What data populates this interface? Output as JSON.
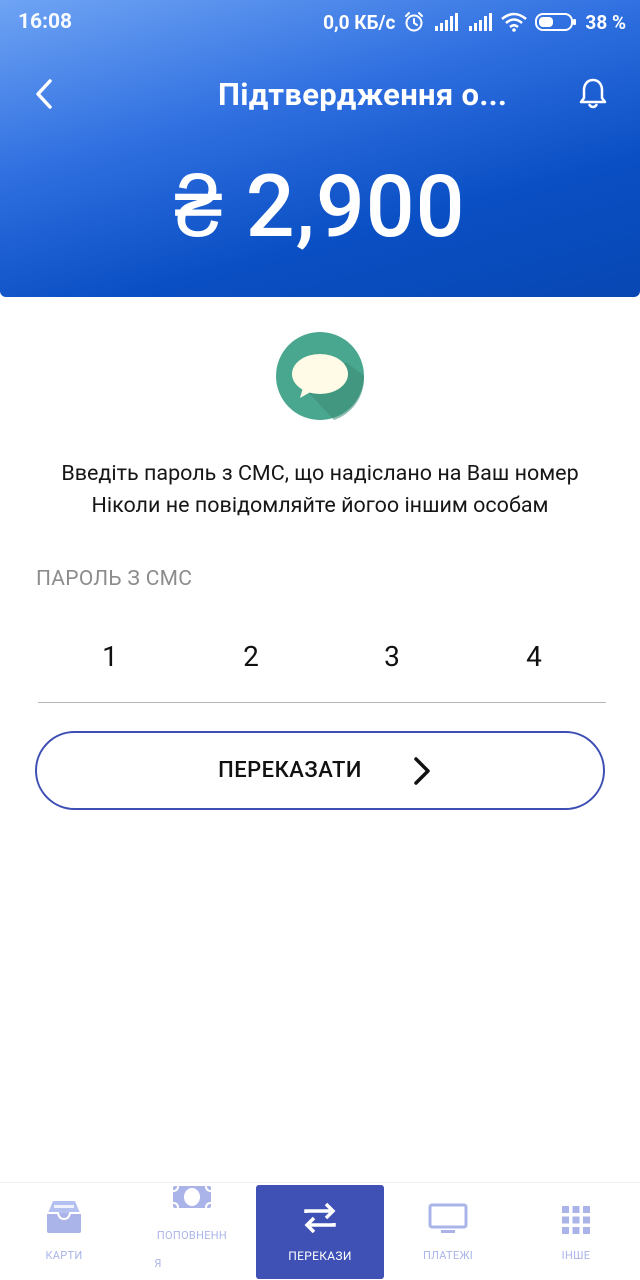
{
  "status_bar": {
    "time": "16:08",
    "speed": "0,0 КБ/с",
    "battery": "38 %",
    "icons": [
      "alarm-icon",
      "signal-icon",
      "signal-icon",
      "wifi-icon",
      "battery-icon"
    ]
  },
  "header": {
    "title": "Підтвердження о...",
    "amount": "₴ 2,900",
    "back_icon": "chevron-left-icon",
    "notification_icon": "bell-icon"
  },
  "illustration": {
    "icon": "sms-chat-bubble-icon",
    "colors": {
      "circle": "#4aa78f",
      "bubble": "#fffbe6"
    }
  },
  "instructions": {
    "line1": "Введіть пароль з СМС, що надіслано на Ваш номер",
    "line2": "Ніколи не повідомляйте йогоо іншим особам"
  },
  "sms_code": {
    "label": "ПАРОЛЬ З СМС",
    "digits": [
      "1",
      "2",
      "3",
      "4"
    ]
  },
  "transfer_button": {
    "label": "ПЕРЕКАЗАТИ",
    "icon": "chevron-right-icon"
  },
  "bottom_nav": {
    "items": [
      {
        "label": "КАРТИ",
        "icon": "cards-tray-icon",
        "active": false
      },
      {
        "label_line1": "ПОПОВНЕНН",
        "label_line2": "Я",
        "icon": "banknote-icon",
        "active": false
      },
      {
        "label": "ПЕРЕКАЗИ",
        "icon": "transfer-arrows-icon",
        "active": true
      },
      {
        "label": "ПЛАТЕЖІ",
        "icon": "monitor-icon",
        "active": false
      },
      {
        "label": "ІНШЕ",
        "icon": "grid-icon",
        "active": false
      }
    ]
  },
  "colors": {
    "header_gradient_start": "#6fa4f4",
    "header_gradient_end": "#0747b3",
    "accent": "#3f51b5",
    "inactive_nav": "#aab4e8"
  }
}
